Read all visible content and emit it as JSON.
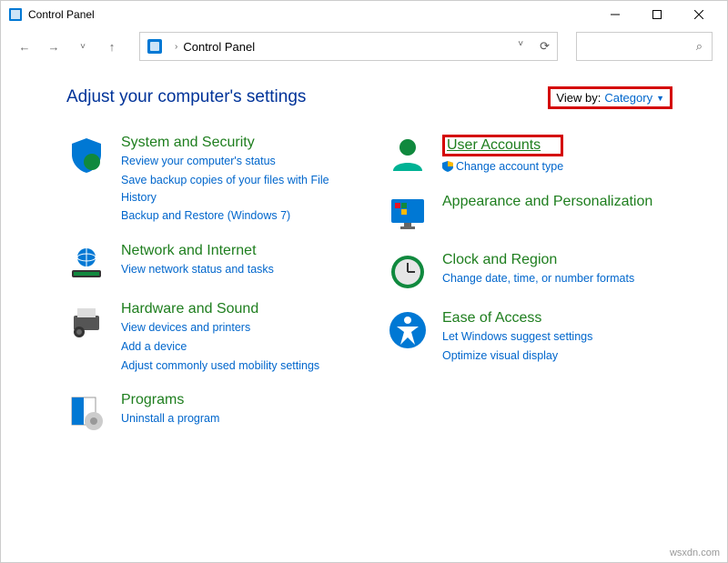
{
  "window": {
    "title": "Control Panel"
  },
  "breadcrumb": {
    "root": "Control Panel"
  },
  "page": {
    "title": "Adjust your computer's settings"
  },
  "viewBy": {
    "label": "View by:",
    "value": "Category"
  },
  "left": {
    "sys": {
      "title": "System and Security",
      "link1": "Review your computer's status",
      "link2": "Save backup copies of your files with File History",
      "link3": "Backup and Restore (Windows 7)"
    },
    "net": {
      "title": "Network and Internet",
      "link1": "View network status and tasks"
    },
    "hw": {
      "title": "Hardware and Sound",
      "link1": "View devices and printers",
      "link2": "Add a device",
      "link3": "Adjust commonly used mobility settings"
    },
    "prog": {
      "title": "Programs",
      "link1": "Uninstall a program"
    }
  },
  "right": {
    "user": {
      "title": "User Accounts",
      "link1": "Change account type"
    },
    "appear": {
      "title": "Appearance and Personalization"
    },
    "clock": {
      "title": "Clock and Region",
      "link1": "Change date, time, or number formats"
    },
    "ease": {
      "title": "Ease of Access",
      "link1": "Let Windows suggest settings",
      "link2": "Optimize visual display"
    }
  },
  "watermark": "wsxdn.com"
}
